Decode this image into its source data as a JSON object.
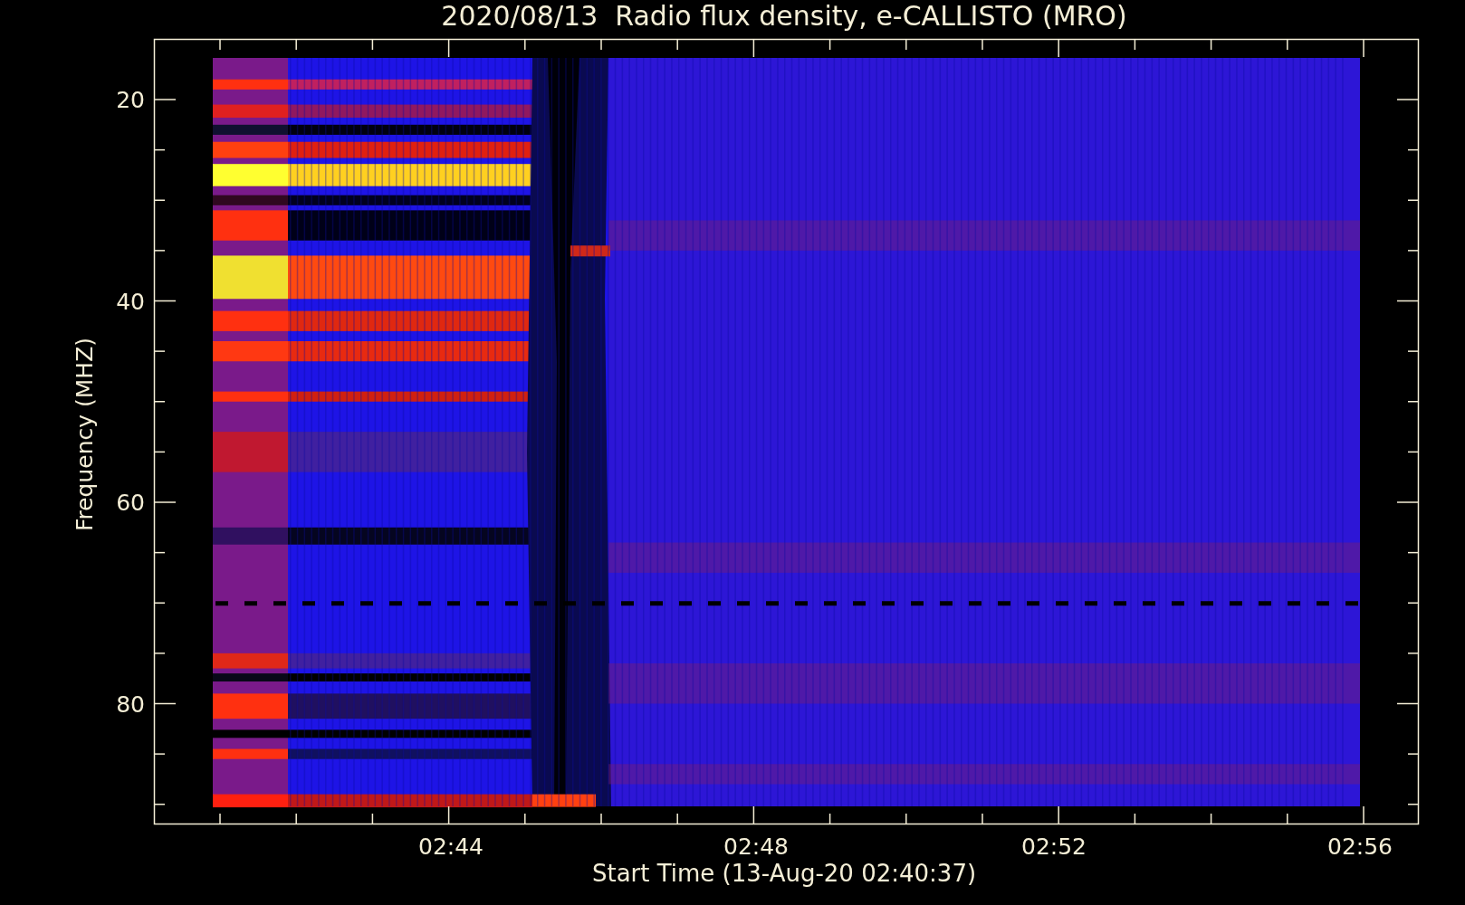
{
  "title": "2020/08/13  Radio flux density, e-CALLISTO (MRO)",
  "y_axis": {
    "label": "Frequency (MHZ)",
    "ticks": [
      "20",
      "40",
      "60",
      "80"
    ]
  },
  "x_axis": {
    "label": "Start Time (13-Aug-20 02:40:37)",
    "ticks": [
      "02:44",
      "02:48",
      "02:52",
      "02:56"
    ]
  }
}
